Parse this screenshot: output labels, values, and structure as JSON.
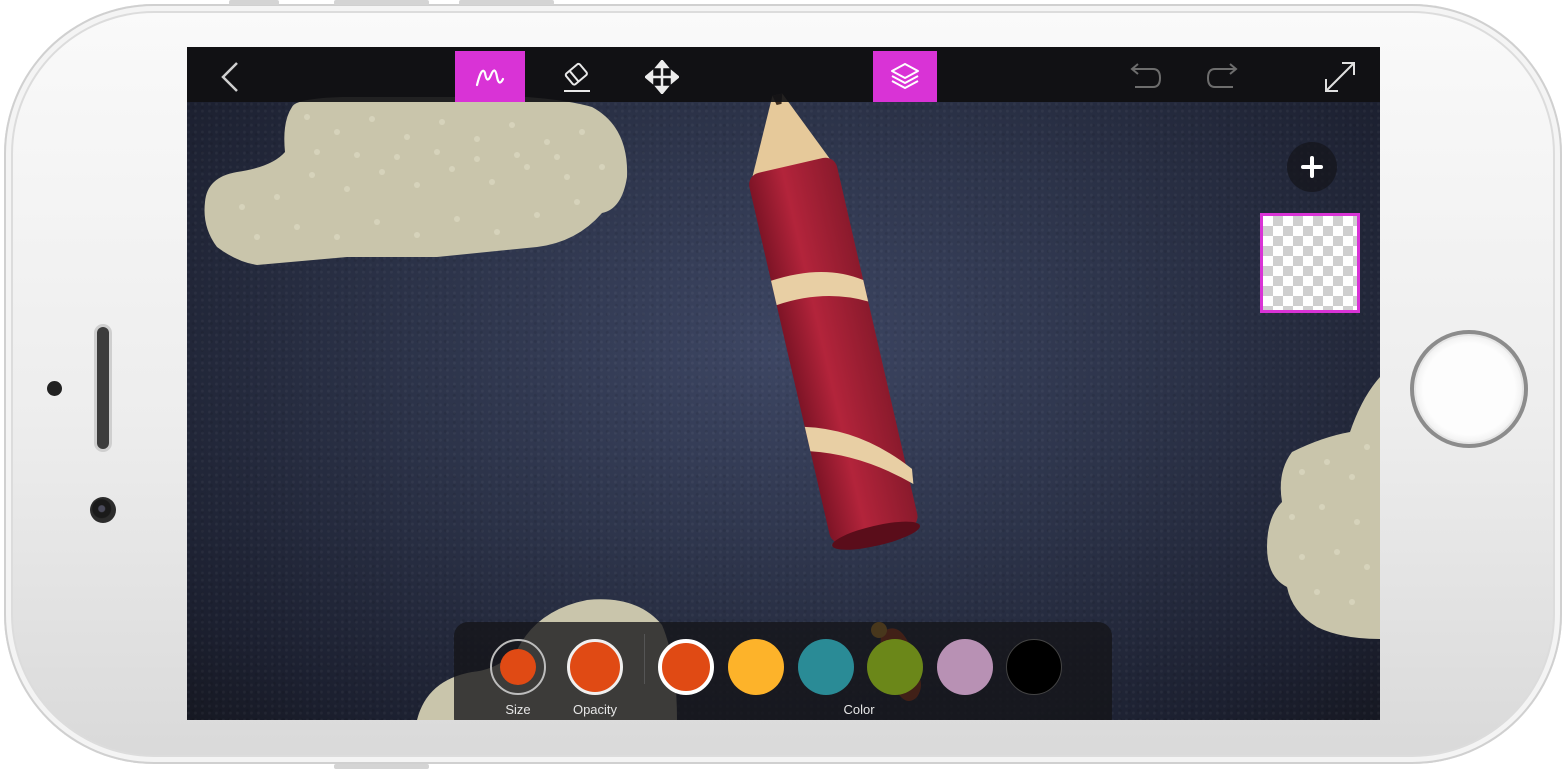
{
  "toolbar": {
    "buttons": [
      {
        "name": "back",
        "icon": "chevron-left-icon",
        "active": false
      },
      {
        "name": "brush",
        "icon": "brush-icon",
        "active": true
      },
      {
        "name": "eraser",
        "icon": "eraser-icon",
        "active": false
      },
      {
        "name": "move",
        "icon": "move-icon",
        "active": false
      },
      {
        "name": "layers",
        "icon": "layers-icon",
        "active": true
      },
      {
        "name": "undo",
        "icon": "undo-icon",
        "active": false
      },
      {
        "name": "redo",
        "icon": "redo-icon",
        "active": false
      },
      {
        "name": "fullscreen",
        "icon": "expand-icon",
        "active": false
      }
    ],
    "accent_color": "#d933d6"
  },
  "layers_panel": {
    "add_icon": "plus-icon",
    "selected_layer": "transparent"
  },
  "palette": {
    "size_label": "Size",
    "opacity_label": "Opacity",
    "color_label": "Color",
    "current_color": "#e04a14",
    "colors": [
      "#e04a14",
      "#fdb32a",
      "#2a8b96",
      "#6b8719",
      "#b891b4",
      "#000000"
    ],
    "selected_index": 0
  }
}
